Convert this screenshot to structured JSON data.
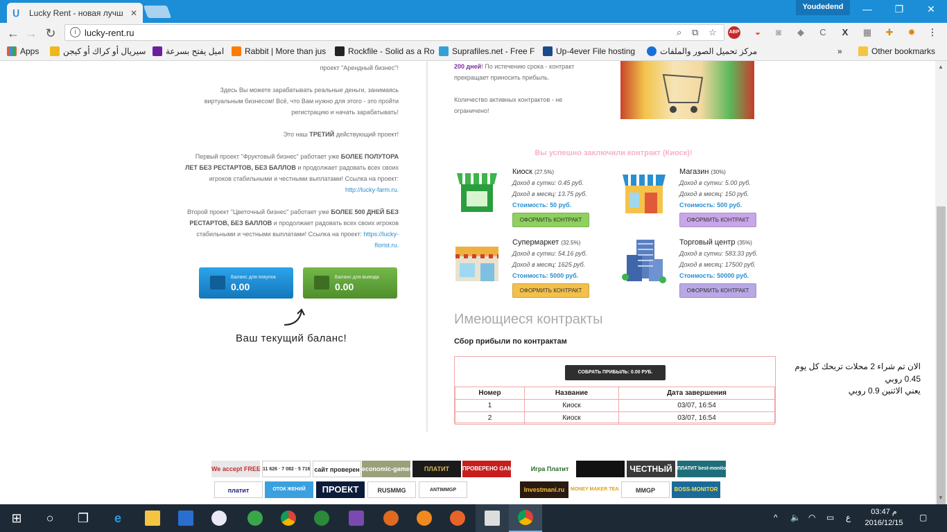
{
  "browser": {
    "tab_title": "Lucky Rent - новая лучш",
    "profile_name": "Youdedend",
    "url": "lucky-rent.ru",
    "bookmarks": [
      {
        "label": "Apps",
        "color": "#e25c3b"
      },
      {
        "label": "سيريال أو كراك أو كيجن",
        "color": "#f1b61c"
      },
      {
        "label": "اميل يفتح بسرعة",
        "color": "#6b1f9a"
      },
      {
        "label": "Rabbit | More than jus",
        "color": "#ff7a00"
      },
      {
        "label": "Rockfile - Solid as a Ro",
        "color": "#222222"
      },
      {
        "label": "Suprafiles.net - Free F",
        "color": "#33a0d8"
      },
      {
        "label": "Up-4ever File hosting",
        "color": "#1a4a8a"
      },
      {
        "label": "مركز تحميل الصور والملفات",
        "color": "#1a6fd8"
      }
    ],
    "bookmarks_more": "»",
    "other_bookmarks": "Other bookmarks"
  },
  "left": {
    "p0": "проект \"Арендный бизнес\"!",
    "p1": "Здесь Вы можете зарабатывать реальные деньги, занимаясь виртуальным бизнесом! Всё, что Вам нужно для этого - это пройти регистрацию и начать зарабатывать!",
    "p2_pre": "Это наш ",
    "p2_bold": "ТРЕТИЙ",
    "p2_post": " действующий проект!",
    "p3_pre": "Первый проект \"Фруктовый бизнес\" работает уже ",
    "p3_bold": "БОЛЕЕ ПОЛУТОРА ЛЕТ БЕЗ РЕСТАРТОВ, БЕЗ БАЛЛОВ",
    "p3_post": " и продолжает радовать всех своих игроков стабильными и честными выплатами! Ссылка на проект: ",
    "p3_link": "http://lucky-farm.ru.",
    "p4_pre": "Второй проект \"Цветочный бизнес\" работает уже ",
    "p4_bold": "БОЛЕЕ 500 ДНЕЙ БЕЗ РЕСТАРТОВ, БЕЗ БАЛЛОВ",
    "p4_post": " и продолжает радовать всех своих игроков стабильными и честными выплатами! Ссылка на проект: ",
    "p4_link": "https://lucky-florist.ru.",
    "balance_buy_label": "Баланс для покупок",
    "balance_buy_value": "0.00",
    "balance_out_label": "Баланс для вывода",
    "balance_out_value": "0.00",
    "handwritten": "Ваш текущий баланс!"
  },
  "right": {
    "days_highlight": "200 дней",
    "term_text": "! По истечению срока - контракт прекращает приносить прибыль.",
    "active_text": "Количество активных контрактов - не ограничено!",
    "success": "Вы успешно заключили контракт (Киоск)!",
    "cards": [
      {
        "name": "Киоск",
        "pct": "(27.5%)",
        "day": "Доход в сутки: 0.45 руб.",
        "month": "Доход в месяц: 13.75 руб.",
        "cost": "Стоимость: 50 руб.",
        "button": "ОФОРМИТЬ КОНТРАКТ",
        "btn_color": "#8fd060",
        "pic_color": "#3cb54a"
      },
      {
        "name": "Магазин",
        "pct": "(30%)",
        "day": "Доход в сутки: 5.00 руб.",
        "month": "Доход в месяц: 150 руб.",
        "cost": "Стоимость: 500 руб.",
        "button": "ОФОРМИТЬ КОНТРАКТ",
        "btn_color": "#c9a6e8",
        "pic_color": "#f2a33a"
      },
      {
        "name": "Супермаркет",
        "pct": "(32.5%)",
        "day": "Доход в сутки: 54.16 руб.",
        "month": "Доход в месяц: 1625 руб.",
        "cost": "Стоимость: 5000 руб.",
        "button": "ОФОРМИТЬ КОНТРАКТ",
        "btn_color": "#f3c04a",
        "pic_color": "#f0b040"
      },
      {
        "name": "Торговый центр",
        "pct": "(35%)",
        "day": "Доход в сутки: 583.33 руб.",
        "month": "Доход в месяц: 17500 руб.",
        "cost": "Стоимость: 50000 руб.",
        "button": "ОФОРМИТЬ КОНТРАКТ",
        "btn_color": "#b9a8e6",
        "pic_color": "#5a7fc0"
      }
    ],
    "contracts_title": "Имеющиеся контракты",
    "profit_title": "Сбор прибыли по контрактам",
    "collect_button": "СОБРАТЬ ПРИБЫЛЬ: 0.00 РУБ.",
    "table_headers": [
      "Номер",
      "Название",
      "Дата завершения"
    ],
    "table_rows": [
      [
        "1",
        "Киоск",
        "03/07, 16:54"
      ],
      [
        "2",
        "Киоск",
        "03/07, 16:54"
      ]
    ]
  },
  "note": {
    "line1": "الان تم شراء 2 محلات تربحك كل يوم",
    "line2": "0.45 روبي",
    "line3": "يعني الاثنين 0.9 روبي"
  },
  "badges_row1": [
    {
      "text": "We accept FREE-KASSA",
      "bg": "#e8e8e8",
      "fg": "#c03030"
    },
    {
      "text": "11 626 · 7 082 · 5 716",
      "bg": "#ffffff",
      "fg": "#333333"
    },
    {
      "text": "сайт проверен",
      "bg": "#ffffff",
      "fg": "#222222"
    },
    {
      "text": "economic-games.ru",
      "bg": "#9aa07a",
      "fg": "#ffffff"
    },
    {
      "text": "ПЛАТИТ",
      "bg": "#1a1a1a",
      "fg": "#d9b55a"
    },
    {
      "text": "ПРОВЕРЕНО GAMEDOOM",
      "bg": "#c81e1e",
      "fg": "#ffffff"
    },
    {
      "text": "Игра Платит",
      "bg": "#ffffff",
      "fg": "#2a6a2a"
    },
    {
      "text": "",
      "bg": "#111111",
      "fg": "#f2c020"
    },
    {
      "text": "ЧЕСТНЫЙ",
      "bg": "#3a3a3a",
      "fg": "#ffffff"
    },
    {
      "text": "ПЛАТИТ best-monitoring.ru",
      "bg": "#1f6f7a",
      "fg": "#ffffff"
    }
  ],
  "badges_row2": [
    {
      "text": "платит",
      "bg": "#ffffff",
      "fg": "#1a1a7a"
    },
    {
      "text": "ОТОК ЖЕНИЙ",
      "bg": "#3aa0e0",
      "fg": "#ffffff"
    },
    {
      "text": "ПРОЕКТ",
      "bg": "#0c1b3a",
      "fg": "#ffffff"
    },
    {
      "text": "RUSMMG",
      "bg": "#ffffff",
      "fg": "#333333"
    },
    {
      "text": "ANTIMMGP",
      "bg": "#ffffff",
      "fg": "#333333"
    },
    {
      "text": "Investmani.ru",
      "bg": "#2a1a10",
      "fg": "#f0c040"
    },
    {
      "text": "MONEY MAKER TEAM",
      "bg": "#ffffff",
      "fg": "#e0a010"
    },
    {
      "text": "MMGP",
      "bg": "#ffffff",
      "fg": "#333333"
    },
    {
      "text": "BOSS-MONITOR",
      "bg": "#1a6a9a",
      "fg": "#ffe040"
    }
  ],
  "taskbar": {
    "time": "03:47 م",
    "date": "2016/12/15",
    "lang": "ع"
  },
  "colors": {
    "chrome_blue": "#1b8ed7",
    "taskbar": "#1d2a36",
    "balance_blue": "#1f8fd6",
    "balance_green": "#5fa83a"
  }
}
